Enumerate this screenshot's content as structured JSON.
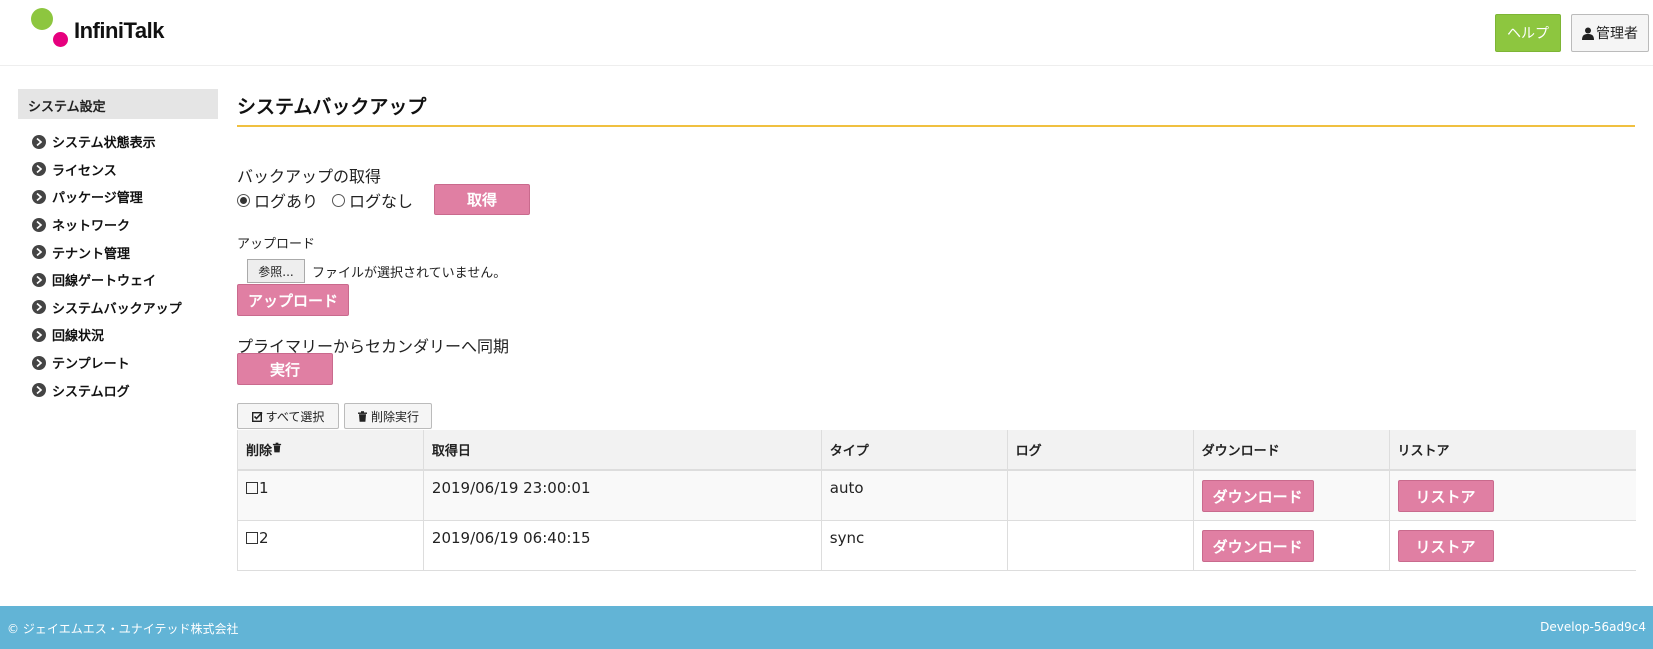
{
  "header": {
    "logo_text": "InfiniTalk",
    "help_label": "ヘルプ",
    "admin_label": "管理者"
  },
  "sidebar": {
    "heading": "システム設定",
    "items": [
      {
        "label": "システム状態表示"
      },
      {
        "label": "ライセンス"
      },
      {
        "label": "パッケージ管理"
      },
      {
        "label": "ネットワーク"
      },
      {
        "label": "テナント管理"
      },
      {
        "label": "回線ゲートウェイ"
      },
      {
        "label": "システムバックアップ"
      },
      {
        "label": "回線状況"
      },
      {
        "label": "テンプレート"
      },
      {
        "label": "システムログ"
      }
    ]
  },
  "main": {
    "title": "システムバックアップ",
    "backup": {
      "label": "バックアップの取得",
      "option_with_log": "ログあり",
      "option_without_log": "ログなし",
      "selected": "ログあり",
      "get_button": "取得"
    },
    "upload": {
      "label": "アップロード",
      "browse_button": "参照...",
      "file_status": "ファイルが選択されていません。",
      "upload_button": "アップロード"
    },
    "sync": {
      "label": "プライマリーからセカンダリーへ同期",
      "exec_button": "実行"
    },
    "toolbar": {
      "select_all": "すべて選択",
      "delete_exec": "削除実行"
    },
    "table": {
      "headers": {
        "delete": "削除",
        "date": "取得日",
        "type": "タイプ",
        "log": "ログ",
        "download": "ダウンロード",
        "restore": "リストア"
      },
      "rows": [
        {
          "id": "1",
          "date": "2019/06/19 23:00:01",
          "type": "auto",
          "log": "",
          "download": "ダウンロード",
          "restore": "リストア"
        },
        {
          "id": "2",
          "date": "2019/06/19 06:40:15",
          "type": "sync",
          "log": "",
          "download": "ダウンロード",
          "restore": "リストア"
        }
      ]
    }
  },
  "footer": {
    "copyright": "© ジェイエムエス・ユナイテッド株式会社",
    "version": "Develop-56ad9c4"
  },
  "colors": {
    "accent_pink": "#e07fa3",
    "help_green": "#8dc63f",
    "title_rule": "#f0c040",
    "footer_blue": "#62b4d6"
  }
}
